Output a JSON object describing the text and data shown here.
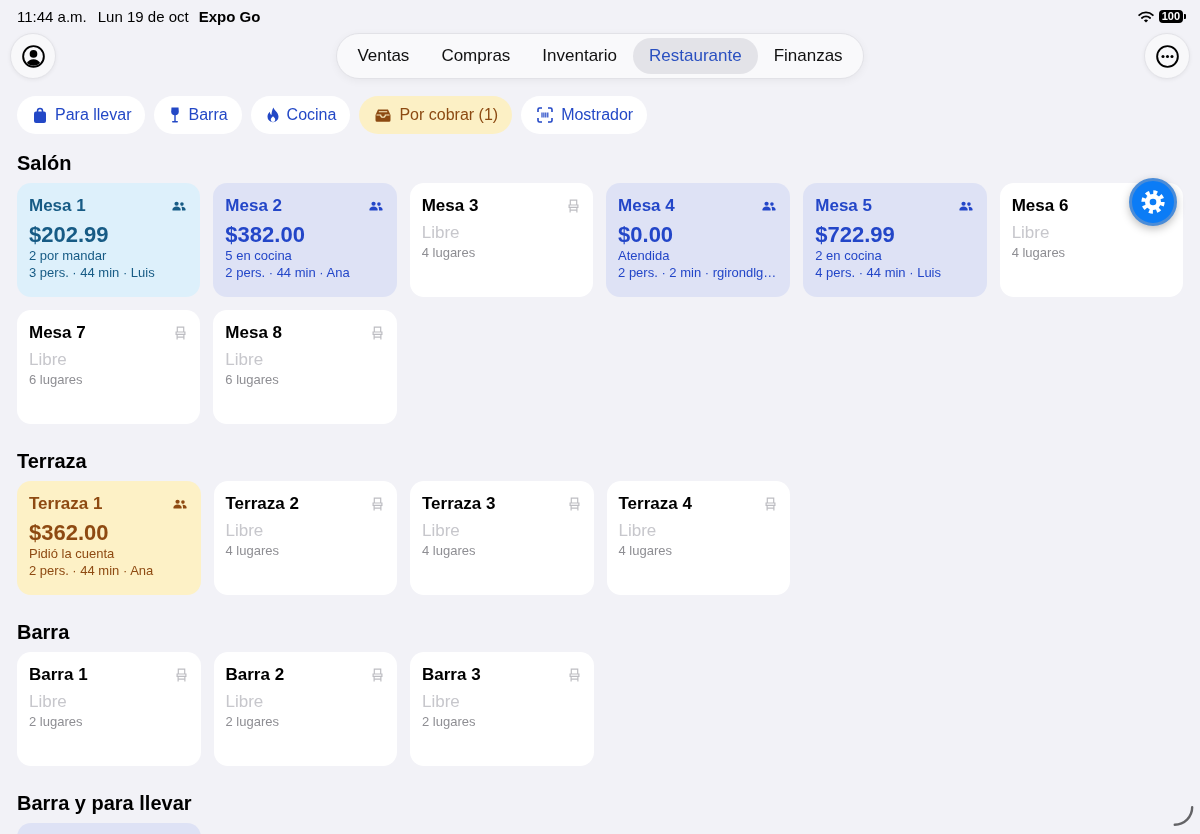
{
  "status_bar": {
    "time": "11:44 a.m.",
    "date": "Lun 19 de oct",
    "app": "Expo Go",
    "battery": "100"
  },
  "tabs": [
    {
      "label": "Ventas",
      "selected": false
    },
    {
      "label": "Compras",
      "selected": false
    },
    {
      "label": "Inventario",
      "selected": false
    },
    {
      "label": "Restaurante",
      "selected": true
    },
    {
      "label": "Finanzas",
      "selected": false
    }
  ],
  "shortcuts": [
    {
      "kind": "takeout",
      "label": "Para llevar",
      "highlighted": false
    },
    {
      "kind": "bar",
      "label": "Barra",
      "highlighted": false
    },
    {
      "kind": "kitchen",
      "label": "Cocina",
      "highlighted": false
    },
    {
      "kind": "billing",
      "label": "Por cobrar (1)",
      "highlighted": true
    },
    {
      "kind": "counter",
      "label": "Mostrador",
      "highlighted": false
    }
  ],
  "sections": [
    {
      "title": "Salón",
      "tables": [
        {
          "kind": "pending",
          "name": "Mesa 1",
          "amount": "$202.99",
          "note": "2 por mandar",
          "details": "3 pers. · 44 min · Luis"
        },
        {
          "kind": "open",
          "name": "Mesa 2",
          "amount": "$382.00",
          "note": "5 en cocina",
          "details": "2 pers. · 44 min · Ana"
        },
        {
          "kind": "free",
          "name": "Mesa 3",
          "availability": "Libre",
          "capacity": "4 lugares"
        },
        {
          "kind": "open",
          "name": "Mesa 4",
          "amount": "$0.00",
          "note": "Atendida",
          "details": "2 pers. · 2 min · rgirondlg…"
        },
        {
          "kind": "open",
          "name": "Mesa 5",
          "amount": "$722.99",
          "note": "2 en cocina",
          "details": "4 pers. · 44 min · Luis"
        },
        {
          "kind": "free",
          "name": "Mesa 6",
          "availability": "Libre",
          "capacity": "4 lugares"
        },
        {
          "kind": "free",
          "name": "Mesa 7",
          "availability": "Libre",
          "capacity": "6 lugares"
        },
        {
          "kind": "free",
          "name": "Mesa 8",
          "availability": "Libre",
          "capacity": "6 lugares"
        }
      ]
    },
    {
      "title": "Terraza",
      "tables": [
        {
          "kind": "bill",
          "name": "Terraza 1",
          "amount": "$362.00",
          "note": "Pidió la cuenta",
          "details": "2 pers. · 44 min · Ana"
        },
        {
          "kind": "free",
          "name": "Terraza 2",
          "availability": "Libre",
          "capacity": "4 lugares"
        },
        {
          "kind": "free",
          "name": "Terraza 3",
          "availability": "Libre",
          "capacity": "4 lugares"
        },
        {
          "kind": "free",
          "name": "Terraza 4",
          "availability": "Libre",
          "capacity": "4 lugares"
        }
      ]
    },
    {
      "title": "Barra",
      "tables": [
        {
          "kind": "free",
          "name": "Barra 1",
          "availability": "Libre",
          "capacity": "2 lugares"
        },
        {
          "kind": "free",
          "name": "Barra 2",
          "availability": "Libre",
          "capacity": "2 lugares"
        },
        {
          "kind": "free",
          "name": "Barra 3",
          "availability": "Libre",
          "capacity": "2 lugares"
        }
      ]
    },
    {
      "title": "Barra y para llevar",
      "tables": [
        {
          "kind": "open"
        }
      ]
    }
  ]
}
